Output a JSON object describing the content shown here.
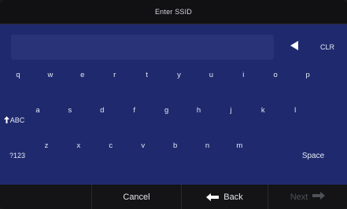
{
  "title": "Enter SSID",
  "keyboard": {
    "clear_label": "CLR",
    "rows": [
      [
        "q",
        "w",
        "e",
        "r",
        "t",
        "y",
        "u",
        "i",
        "o",
        "p"
      ],
      [
        "a",
        "s",
        "d",
        "f",
        "g",
        "h",
        "j",
        "k",
        "l"
      ],
      [
        "z",
        "x",
        "c",
        "v",
        "b",
        "n",
        "m"
      ]
    ],
    "shift_label": "ABC",
    "symbols_label": "?123",
    "space_label": "Space"
  },
  "bottom": {
    "cancel_label": "Cancel",
    "back_label": "Back",
    "next_label": "Next"
  },
  "colors": {
    "keyboard_bg": "#1f2a6e",
    "title_bg": "#111113",
    "bottom_bg": "#141416",
    "text": "#e4e8f4",
    "disabled_text": "#4f5158"
  },
  "icons": {
    "backspace": "triangle-left-icon",
    "shift": "arrow-up-icon",
    "back": "arrow-left-icon",
    "next": "arrow-right-icon"
  }
}
